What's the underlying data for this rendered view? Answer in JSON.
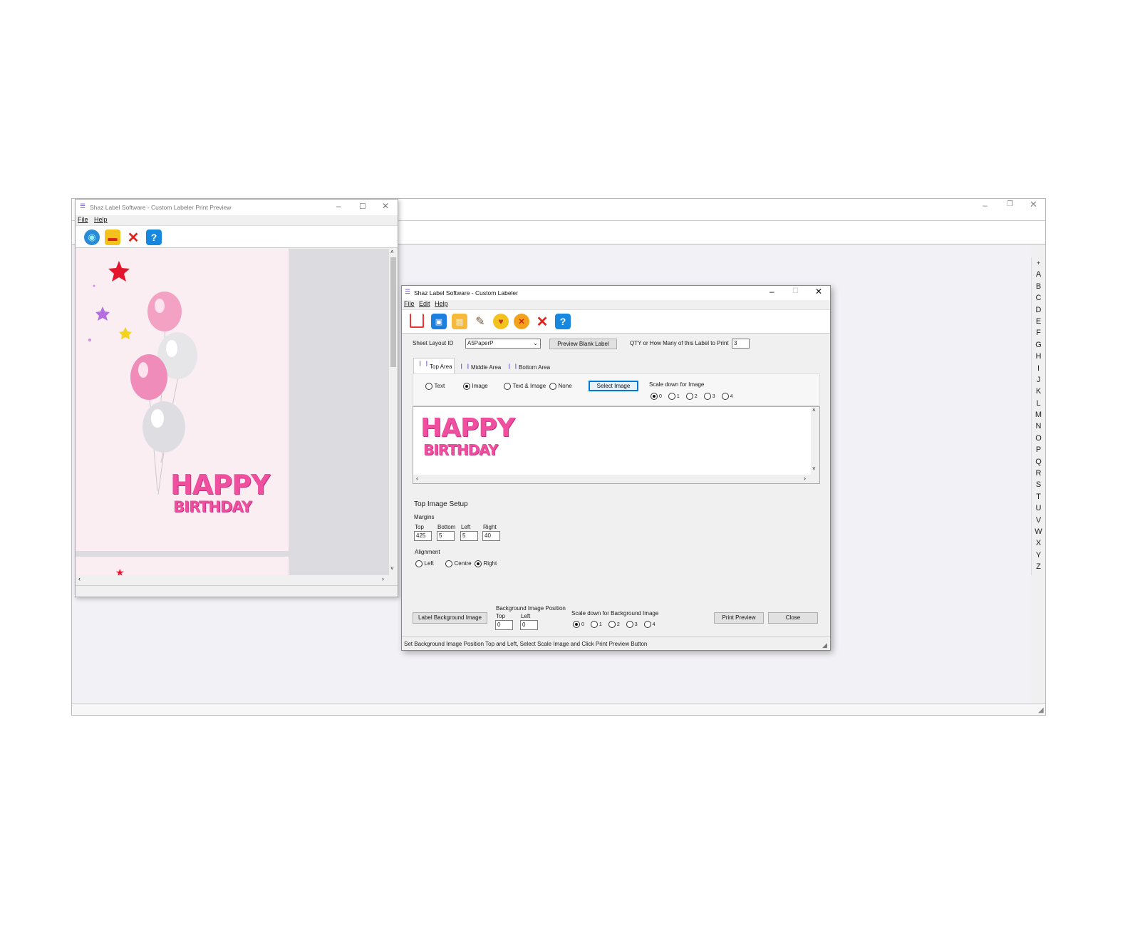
{
  "main_window": {
    "az_index": [
      "+",
      "A",
      "B",
      "C",
      "D",
      "E",
      "F",
      "G",
      "H",
      "I",
      "J",
      "K",
      "L",
      "M",
      "N",
      "O",
      "P",
      "Q",
      "R",
      "S",
      "T",
      "U",
      "V",
      "W",
      "X",
      "Y",
      "Z"
    ]
  },
  "preview_window": {
    "title": "Shaz Label Software - Custom Labeler Print Preview",
    "menu": {
      "file": "File",
      "help": "Help"
    },
    "card_text": {
      "line1": "HAPPY",
      "line2": "BIRTHDAY"
    }
  },
  "labeler_window": {
    "title": "Shaz Label Software - Custom Labeler",
    "menu": {
      "file": "File",
      "edit": "Edit",
      "help": "Help"
    },
    "sheet_layout_label": "Sheet Layout ID",
    "sheet_layout_value": "A5PaperP",
    "preview_blank_label": "Preview Blank Label",
    "qty_label": "QTY or How Many of this Label to Print",
    "qty_value": "3",
    "tabs": {
      "top": "Top Area",
      "middle": "Middle Area",
      "bottom": "Bottom Area"
    },
    "content_options": {
      "text": "Text",
      "image": "Image",
      "text_image": "Text & Image",
      "none": "None"
    },
    "select_image": "Select Image",
    "scale_image_label": "Scale down for Image",
    "scale_options": [
      "0",
      "1",
      "2",
      "3",
      "4"
    ],
    "image_text": {
      "line1": "HAPPY",
      "line2": "BIRTHDAY"
    },
    "setup_title": "Top Image Setup",
    "margins_label": "Margins",
    "margin_labels": {
      "top": "Top",
      "bottom": "Bottom",
      "left": "Left",
      "right": "Right"
    },
    "margin_values": {
      "top": "425",
      "bottom": "5",
      "left": "5",
      "right": "40"
    },
    "alignment_label": "Alignment",
    "alignment_options": {
      "left": "Left",
      "centre": "Centre",
      "right": "Right"
    },
    "bg_button": "Label Background Image",
    "bg_position_label": "Background Image Position",
    "bg_top_label": "Top",
    "bg_left_label": "Left",
    "bg_top_value": "0",
    "bg_left_value": "0",
    "bg_scale_label": "Scale down for Background Image",
    "print_preview": "Print Preview",
    "close": "Close",
    "status": "Set Background Image Position Top and Left, Select Scale Image and Click Print Preview Button"
  },
  "colors": {
    "accent_pink": "#ef4f9e",
    "window_bg": "#f0f0f0",
    "focus_blue": "#0078d7"
  }
}
